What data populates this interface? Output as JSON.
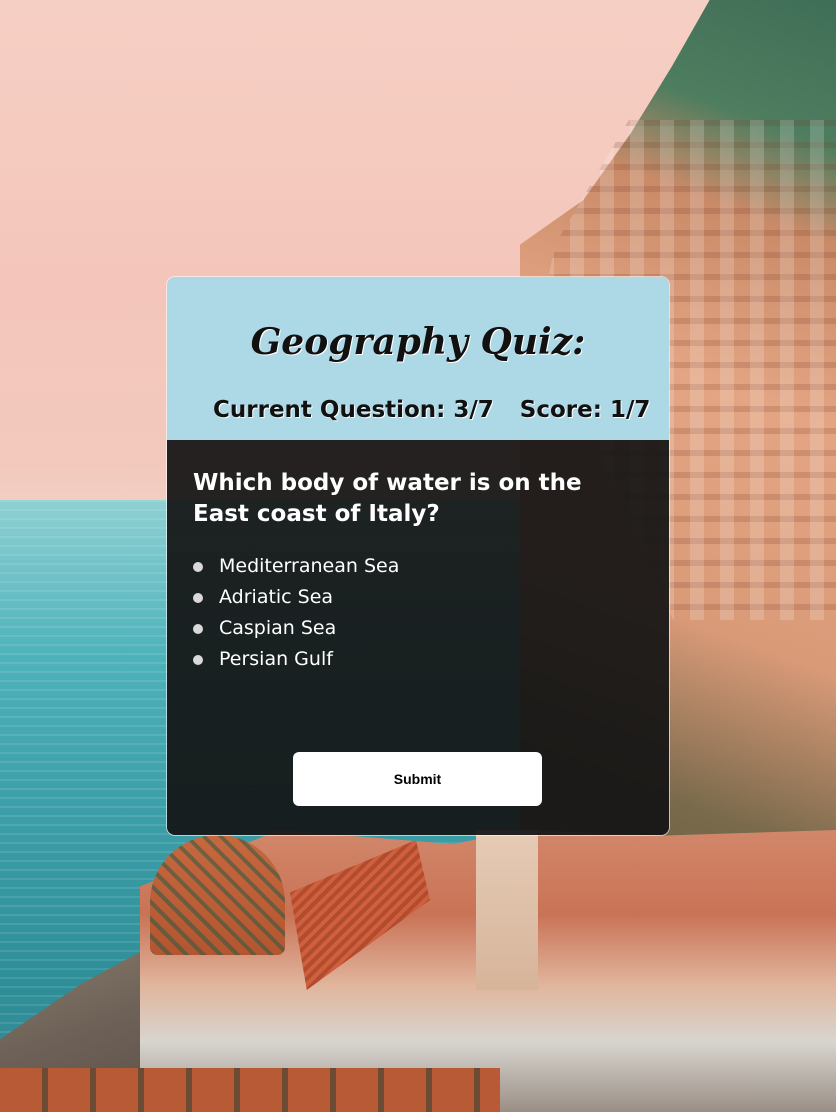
{
  "quiz": {
    "title": "Geography Quiz:",
    "current_question": "Current Question: 3/7",
    "score": "Score: 1/7",
    "question": "Which body of water is on the East coast of Italy?",
    "answers": [
      {
        "label": "Mediterranean Sea"
      },
      {
        "label": "Adriatic Sea"
      },
      {
        "label": "Caspian Sea"
      },
      {
        "label": "Persian Gulf"
      }
    ],
    "submit_label": "Submit"
  },
  "colors": {
    "header_background": "#add8e6",
    "body_background": "#141414",
    "button_background": "#ffffff",
    "text_light": "#ffffff",
    "text_dark": "#111111"
  },
  "icons": {
    "answer_bullet": "circle-bullet-icon"
  }
}
